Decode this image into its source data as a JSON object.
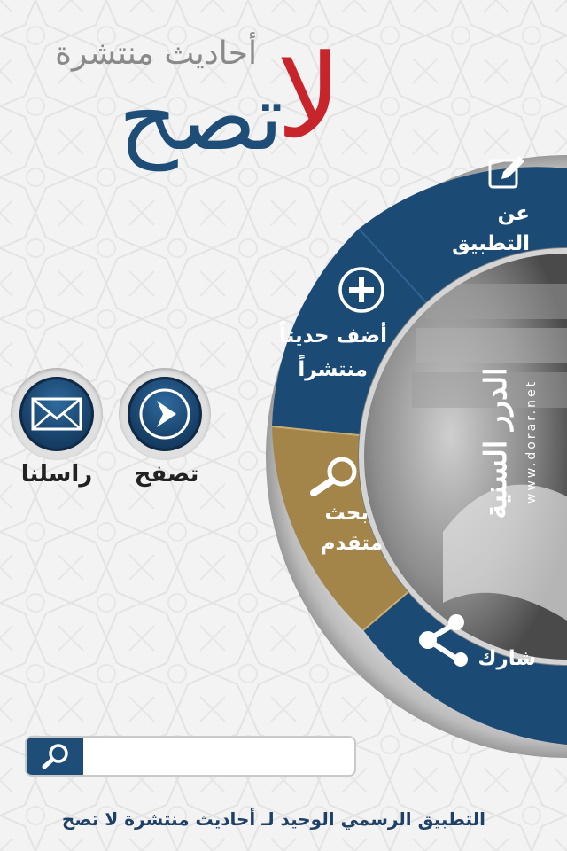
{
  "header": {
    "subtitle": "أحاديث منتشرة",
    "title_main": "تصح",
    "title_negation": "لا"
  },
  "menu": {
    "about": "عن التطبيق",
    "add_line1": "أضف حديثاً",
    "add_line2": "منتشراً",
    "search_line1": "بحث",
    "search_line2": "متقدم",
    "share": "شارك"
  },
  "center": {
    "brand_arabic": "الدرر السنية",
    "brand_url": "www.dorar.net"
  },
  "actions": {
    "browse_label": "تصفح",
    "contact_label": "راسلنا"
  },
  "search": {
    "placeholder": ""
  },
  "footer": {
    "text": "التطبيق الرسمي الوحيد لـ أحاديث منتشرة لا تصح"
  },
  "colors": {
    "navy": "#1e4d78",
    "gold": "#a3854a",
    "red": "#c8242b",
    "background": "#f3f3f3"
  },
  "icons": {
    "about": "edit-icon",
    "add": "plus-circle-icon",
    "search": "magnifier-icon",
    "share": "share-icon",
    "browse": "play-arrow-icon",
    "contact": "envelope-icon"
  }
}
